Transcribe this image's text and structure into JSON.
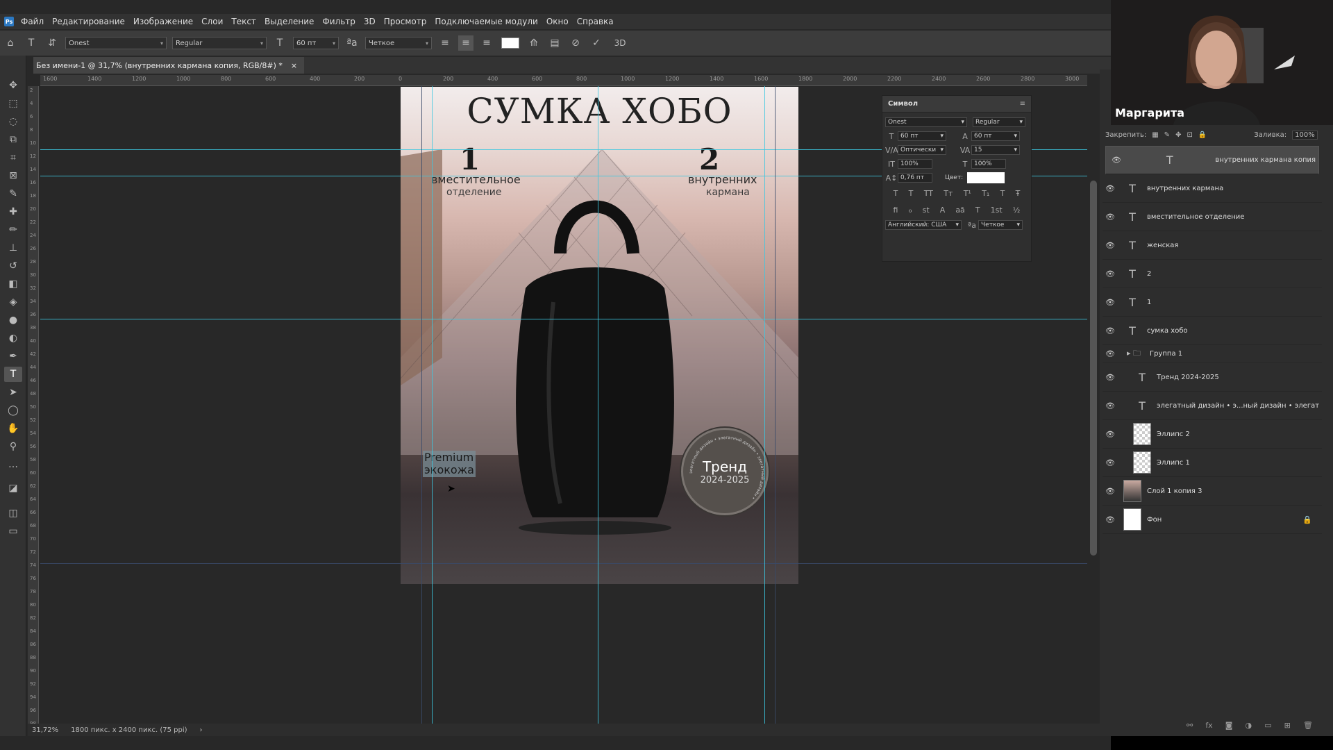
{
  "menu": [
    "Файл",
    "Редактирование",
    "Изображение",
    "Слои",
    "Текст",
    "Выделение",
    "Фильтр",
    "3D",
    "Просмотр",
    "Подключаемые модули",
    "Окно",
    "Справка"
  ],
  "options": {
    "font_family": "Onest",
    "font_style": "Regular",
    "font_size": "60 пт",
    "antialias": "Четкое",
    "label_3d": "3D"
  },
  "document_tab": {
    "title": "Без имени-1 @ 31,7% (внутренних кармана копия, RGB/8#) *",
    "close": "×"
  },
  "ruler_top_ticks": [
    "1600",
    "1400",
    "1200",
    "1000",
    "800",
    "600",
    "400",
    "200",
    "0",
    "200",
    "400",
    "600",
    "800",
    "1000",
    "1200",
    "1400",
    "1600",
    "1800",
    "2000",
    "2200",
    "2400",
    "2600",
    "2800",
    "3000"
  ],
  "ruler_left_ticks": [
    "2",
    "4",
    "6",
    "8",
    "10",
    "12",
    "14",
    "16",
    "18",
    "20",
    "22",
    "24",
    "26",
    "28",
    "30",
    "32",
    "34",
    "36",
    "38",
    "40",
    "42",
    "44",
    "46",
    "48",
    "50",
    "52",
    "54",
    "56",
    "58",
    "60",
    "62",
    "64",
    "66",
    "68",
    "70",
    "72",
    "74",
    "76",
    "78",
    "80",
    "82",
    "84",
    "86",
    "88",
    "90",
    "92",
    "94",
    "96",
    "98"
  ],
  "doc": {
    "title": "СУМКА ХОБО",
    "num1": "1",
    "num1_line1": "вместительное",
    "num1_line2": "отделение",
    "num2": "2",
    "num2_line1": "внутренних",
    "num2_line2": "кармана",
    "premium_line1": "Premium",
    "premium_line2": "экокожа",
    "badge_title": "Тренд",
    "badge_sub": "2024-2025",
    "badge_ring": "элегатный дизайн • элегатный дизайн • элегатный дизайн •"
  },
  "character_panel": {
    "title": "Символ",
    "font": "Onest",
    "style": "Regular",
    "size": "60 пт",
    "leading": "60 пт",
    "kerning": "Оптически",
    "tracking": "15",
    "vscale": "100%",
    "hscale": "100%",
    "baseline": "0,76 пт",
    "color_label": "Цвет:",
    "language": "Английский: США",
    "aa": "Четкое",
    "glyphs_row1": [
      "T",
      "T",
      "TT",
      "Tт",
      "T¹",
      "T₁",
      "T",
      "Ŧ"
    ],
    "glyphs_row2": [
      "fi",
      "ℴ",
      "st",
      "A",
      "aā",
      "T",
      "1st",
      "½"
    ]
  },
  "webcam": {
    "name": "Маргарита"
  },
  "layers_panel": {
    "lock_label": "Закрепить:",
    "fill_label": "Заливка:",
    "fill_value": "100%",
    "layers": [
      {
        "name": "внутренних кармана копия",
        "kind": "text",
        "selected": true
      },
      {
        "name": "внутренних кармана",
        "kind": "text"
      },
      {
        "name": "вместительное отделение",
        "kind": "text"
      },
      {
        "name": "женская",
        "kind": "text"
      },
      {
        "name": "2",
        "kind": "text"
      },
      {
        "name": "1",
        "kind": "text"
      },
      {
        "name": "сумка хобо",
        "kind": "text"
      },
      {
        "name": "Группа 1",
        "kind": "group"
      },
      {
        "name": "Тренд 2024-2025",
        "kind": "text",
        "indent": true
      },
      {
        "name": "элегатный дизайн • э...ный дизайн • элегат",
        "kind": "text",
        "indent": true
      },
      {
        "name": "Эллипс 2",
        "kind": "shape",
        "indent": true
      },
      {
        "name": "Эллипс 1",
        "kind": "shape",
        "indent": true
      },
      {
        "name": "Слой 1 копия 3",
        "kind": "image"
      },
      {
        "name": "Фон",
        "kind": "bg",
        "locked": true
      }
    ]
  },
  "status": {
    "zoom": "31,72%",
    "size": "1800 пикс. x 2400 пикс. (75 ppi)"
  }
}
